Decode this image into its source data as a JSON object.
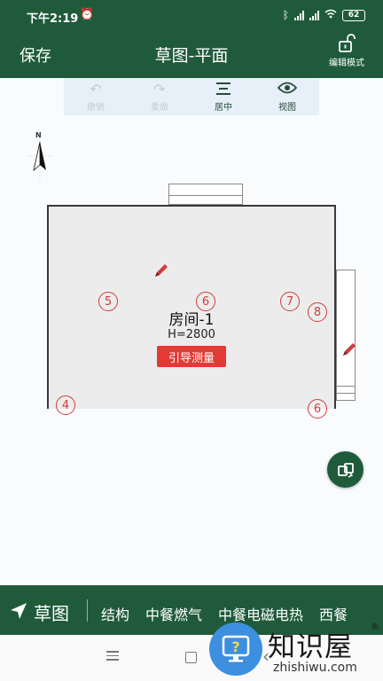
{
  "status_bar": {
    "time": "下午2:19",
    "battery": "62"
  },
  "app_bar": {
    "save_label": "保存",
    "title": "草图-平面",
    "edit_mode_label": "编辑模式"
  },
  "toolbar": {
    "items": [
      {
        "label": "撤销",
        "icon": "undo-icon",
        "enabled": false
      },
      {
        "label": "重做",
        "icon": "redo-icon",
        "enabled": false
      },
      {
        "label": "居中",
        "icon": "center-icon",
        "enabled": true
      },
      {
        "label": "视图",
        "icon": "eye-icon",
        "enabled": true
      }
    ]
  },
  "compass": {
    "north_label": "N"
  },
  "room": {
    "name": "房间-1",
    "height": "H=2800",
    "measure_button": "引导测量",
    "walls": [
      "4",
      "5",
      "6",
      "7",
      "8",
      "6"
    ]
  },
  "bottom_bar": {
    "active_tab": "草图",
    "categories": [
      "结构",
      "中餐燃气",
      "中餐电磁电热",
      "西餐"
    ]
  },
  "watermark": {
    "logo_text": "知识屋",
    "registered": "®",
    "url": "zhishiwu.com"
  },
  "colors": {
    "primary_green": "#1f5b3a",
    "accent_red": "#e53935",
    "wall_number_red": "#d23c3c",
    "toolbar_bg": "#e7f0f9"
  }
}
